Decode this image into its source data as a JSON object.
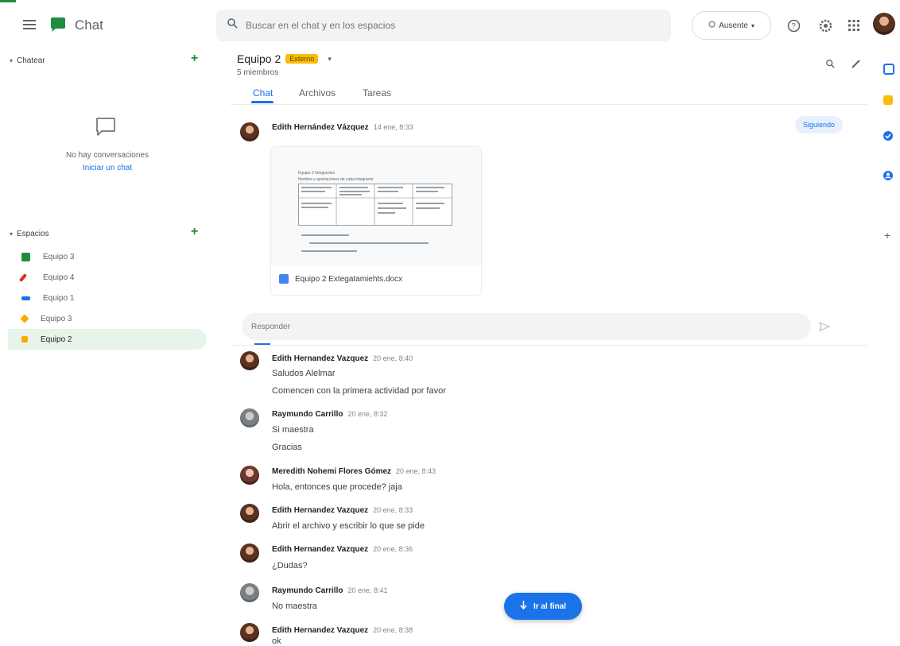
{
  "app": {
    "title": "Chat"
  },
  "search": {
    "placeholder": "Buscar en el chat y en los espacios"
  },
  "status": {
    "label": "Ausente"
  },
  "sidebar": {
    "chat_section": "Chatear",
    "empty_text": "No hay conversaciones",
    "start_chat": "Iniciar un chat",
    "spaces_section": "Espacios",
    "spaces": [
      {
        "label": "Equipo 3",
        "color": "#1e8e3e"
      },
      {
        "label": "Equipo 4",
        "color": "#d93025"
      },
      {
        "label": "Equipo 1",
        "color": "#1a73e8"
      },
      {
        "label": "Equipo 3",
        "color": "#f9ab00"
      },
      {
        "label": "Equipo 2",
        "color": "#f9ab00"
      }
    ]
  },
  "room": {
    "title": "Equipo 2",
    "badge": "Externo",
    "members": "5 miembros",
    "tabs": [
      "Chat",
      "Archivos",
      "Tareas"
    ],
    "following": "Siguiendo"
  },
  "thread": {
    "author": "Edith Hernández Vázquez",
    "time": "14 ene, 8:33",
    "attachment": "Equipo 2 Extegatamiehts.docx",
    "doc_lines": [
      "Equipo 2 Integrantes",
      "Nombre y aportaciones de cada integrante"
    ]
  },
  "reply": {
    "placeholder": "Responder"
  },
  "messages": [
    {
      "author": "Edith Hernandez Vazquez",
      "time": "20 ene, 8:40",
      "avatar": "brown",
      "lines": [
        "Saludos Alelmar",
        "Comencen con la primera actividad por favor"
      ]
    },
    {
      "author": "Raymundo Carrillo",
      "time": "20 ene, 8:32",
      "avatar": "gray",
      "lines": [
        "Si maestra",
        "Gracias"
      ]
    },
    {
      "author": "Meredith Nohemi Flores Gómez",
      "time": "20 ene, 8:43",
      "avatar": "pink",
      "lines": [
        "Hola, entonces que procede? jaja"
      ]
    },
    {
      "author": "Edith Hernandez Vazquez",
      "time": "20 ene, 8:33",
      "avatar": "brown",
      "lines": [
        "Abrir el archivo y escribir lo que se pide"
      ]
    },
    {
      "author": "Edith Hernandez Vazquez",
      "time": "20 ene, 8:36",
      "avatar": "brown",
      "lines": [
        "¿Dudas?"
      ]
    },
    {
      "author": "Raymundo Carrillo",
      "time": "20 ene, 8:41",
      "avatar": "gray",
      "lines": [
        "No maestra"
      ]
    },
    {
      "author": "Edith Hernandez Vazquez",
      "time": "20 ene, 8:38",
      "avatar": "brown",
      "lines": [
        "ok"
      ]
    }
  ],
  "jump": {
    "label": "Ir al final"
  }
}
